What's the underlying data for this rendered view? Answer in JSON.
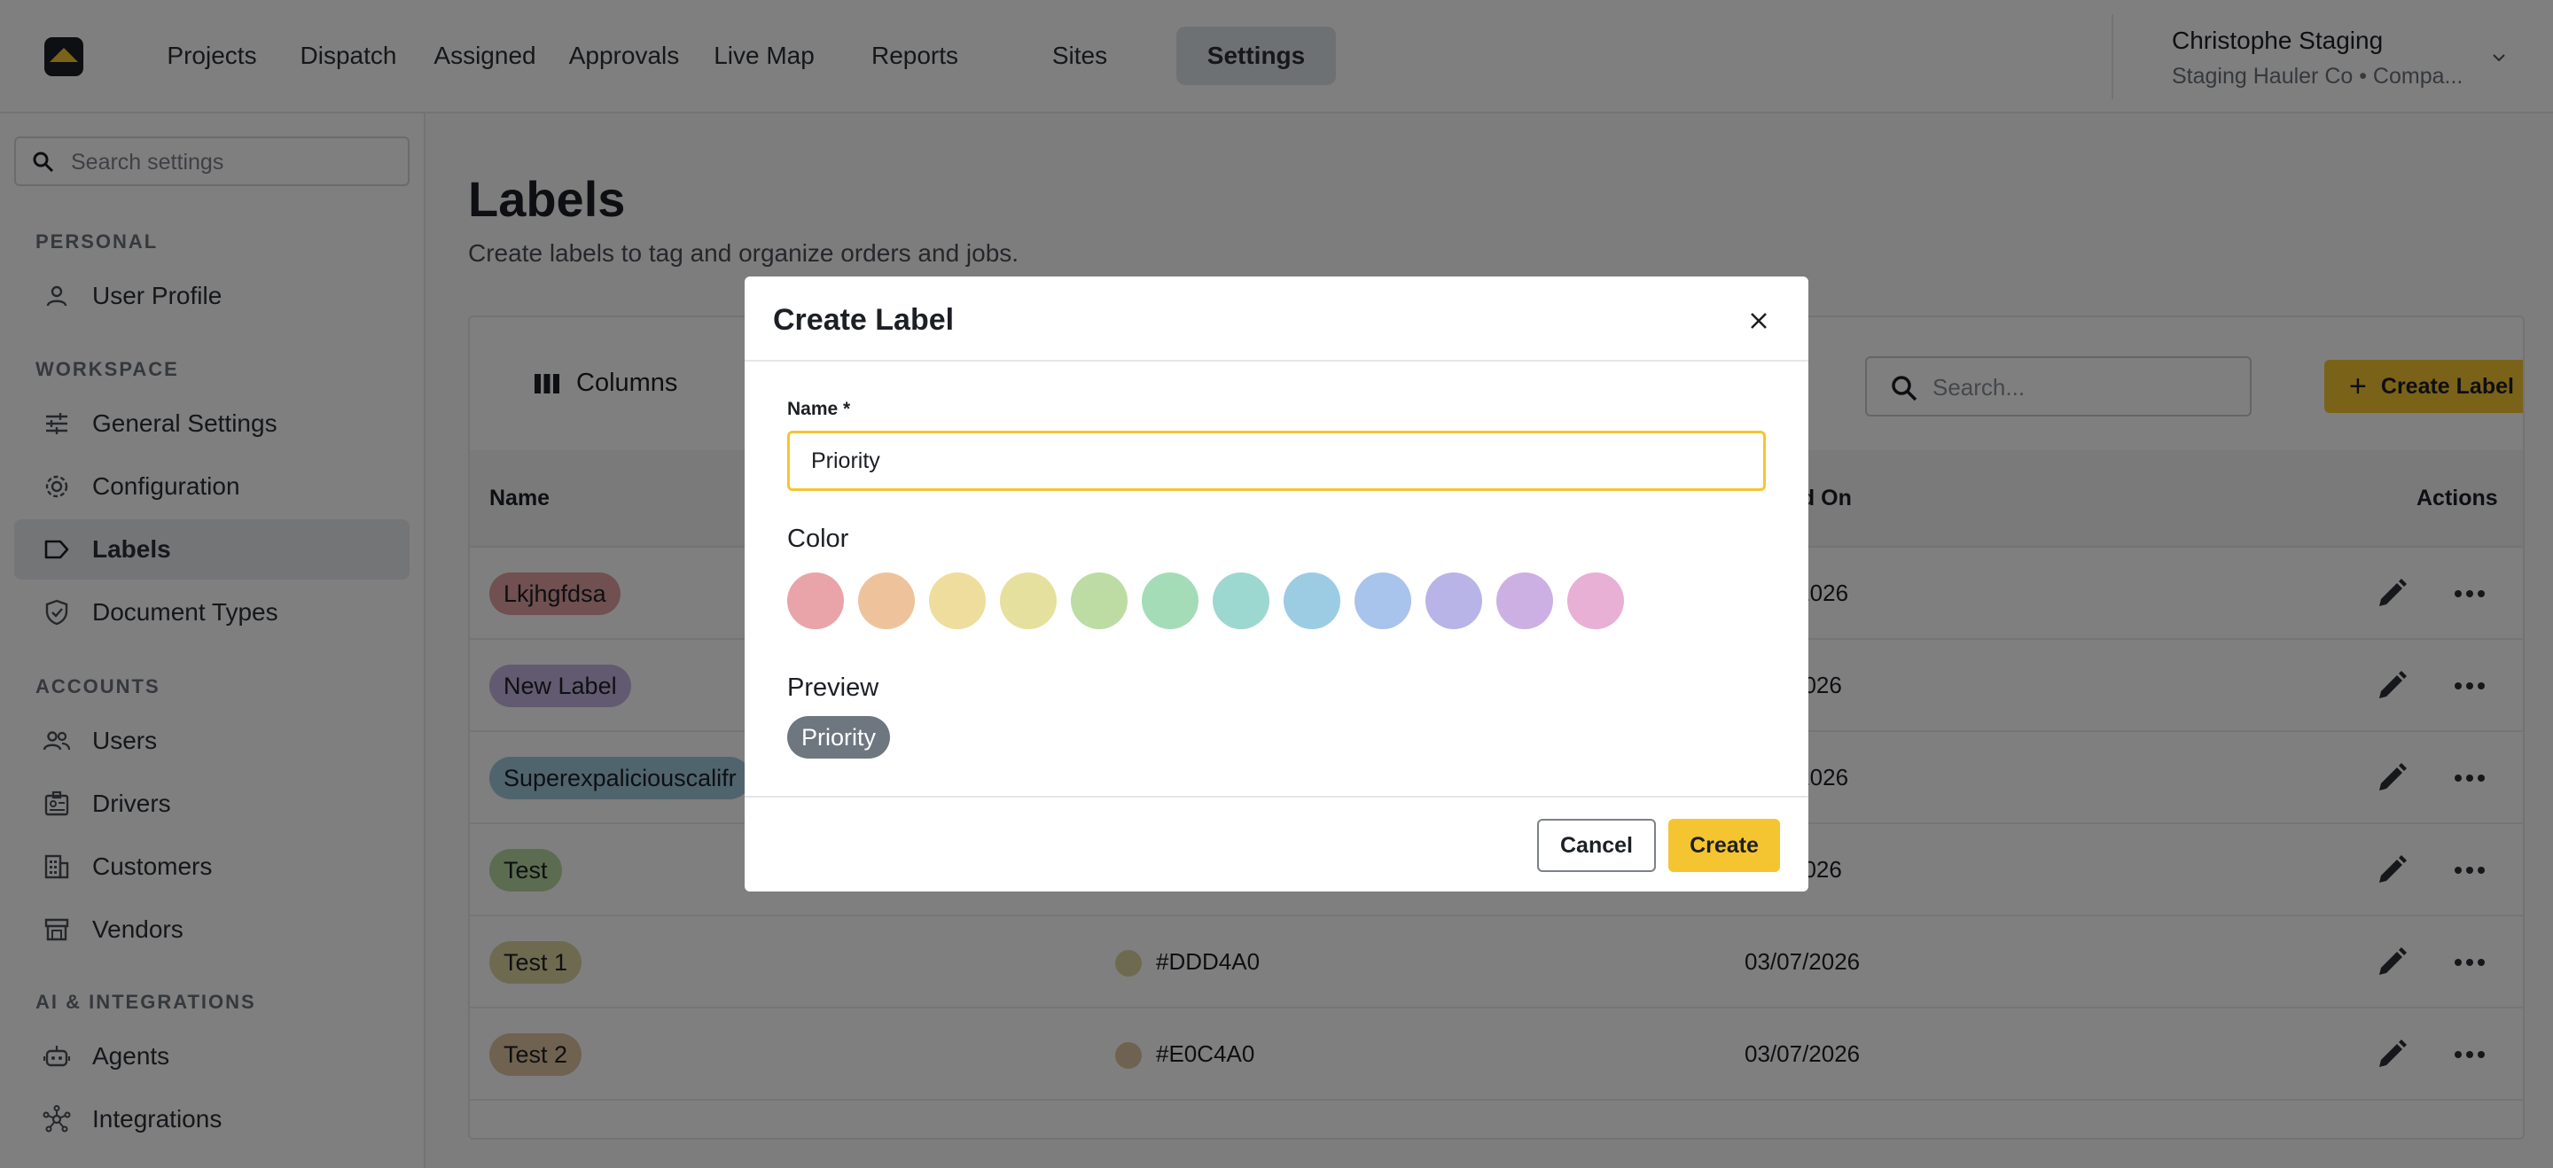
{
  "nav": {
    "items": [
      {
        "label": "Projects",
        "active": false
      },
      {
        "label": "Dispatch",
        "active": false
      },
      {
        "label": "Assigned",
        "active": false
      },
      {
        "label": "Approvals",
        "active": false
      },
      {
        "label": "Live Map",
        "active": false
      },
      {
        "label": "Reports",
        "active": false
      },
      {
        "label": "Sites",
        "active": false
      },
      {
        "label": "Settings",
        "active": true
      }
    ],
    "account": {
      "name": "Christophe Staging",
      "subtitle": "Staging Hauler Co • Compa..."
    }
  },
  "sidebar": {
    "search_placeholder": "Search settings",
    "sections": {
      "personal": "PERSONAL",
      "workspace": "WORKSPACE",
      "accounts": "ACCOUNTS",
      "ai": "AI & INTEGRATIONS"
    },
    "items": {
      "user_profile": "User Profile",
      "general_settings": "General Settings",
      "configuration": "Configuration",
      "labels": "Labels",
      "document_types": "Document Types",
      "users": "Users",
      "drivers": "Drivers",
      "customers": "Customers",
      "vendors": "Vendors",
      "agents": "Agents",
      "integrations": "Integrations"
    },
    "active": "labels"
  },
  "main": {
    "title": "Labels",
    "subtitle": "Create labels to tag and organize orders and jobs.",
    "columns_label": "Columns",
    "search_placeholder": "Search...",
    "create_label": "Create Label",
    "table": {
      "headers": {
        "name": "Name",
        "created_on": "ed On",
        "actions": "Actions"
      },
      "rows": [
        {
          "name": "Lkjhgfdsa",
          "pill_color": "#E0A0A0",
          "hex": "",
          "date": "/2026"
        },
        {
          "name": "New Label",
          "pill_color": "#C4B4E0",
          "hex": "",
          "date": "2026"
        },
        {
          "name": "Superexpaliciouscalifr",
          "pill_color": "#A0C8DD",
          "hex": "",
          "date": "/2026"
        },
        {
          "name": "Test",
          "pill_color": "#B8D8A0",
          "hex": "",
          "date": "2026"
        },
        {
          "name": "Test 1",
          "pill_color": "#DDD4A0",
          "hex": "#DDD4A0",
          "date": "03/07/2026"
        },
        {
          "name": "Test 2",
          "pill_color": "#E0C4A0",
          "hex": "#E0C4A0",
          "date": "03/07/2026"
        }
      ]
    }
  },
  "modal": {
    "title": "Create Label",
    "name_label": "Name *",
    "name_value": "Priority",
    "color_label": "Color",
    "swatches": [
      "#E8A4A8",
      "#EEC39C",
      "#EEDD9C",
      "#E6E09E",
      "#BCDCA4",
      "#A4DCB8",
      "#9CD8D0",
      "#9CCCE4",
      "#A8C4EC",
      "#B8B4E8",
      "#CCB0E4",
      "#E8B0D4"
    ],
    "preview_label": "Preview",
    "preview_text": "Priority",
    "cancel": "Cancel",
    "create": "Create"
  },
  "colors": {
    "accent": "#F4C531",
    "preview_pill": "#6E7780"
  }
}
